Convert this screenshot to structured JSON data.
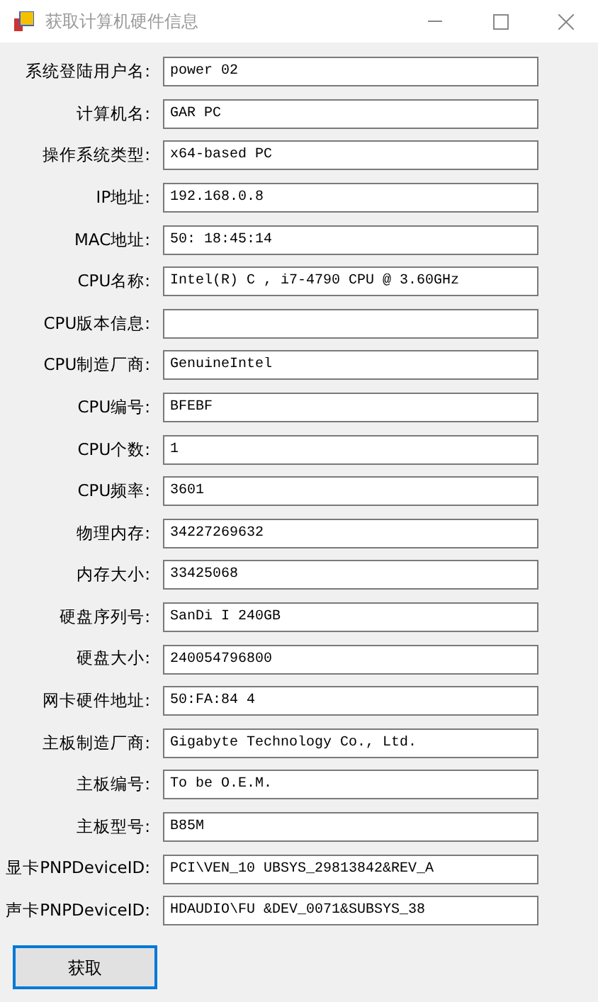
{
  "window": {
    "title": "获取计算机硬件信息"
  },
  "fields": [
    {
      "label": "系统登陆用户名:",
      "value": "power 02"
    },
    {
      "label": "计算机名:",
      "value": "GAR PC"
    },
    {
      "label": "操作系统类型:",
      "value": "x64-based PC"
    },
    {
      "label": "IP地址:",
      "value": "192.168.0.8"
    },
    {
      "label": "MAC地址:",
      "value": "50: 18:45:14"
    },
    {
      "label": "CPU名称:",
      "value": "Intel(R) C , i7-4790 CPU @ 3.60GHz"
    },
    {
      "label": "CPU版本信息:"
    },
    {
      "label": "CPU制造厂商:",
      "value": "GenuineIntel"
    },
    {
      "label": "CPU编号:",
      "value": "BFEBF"
    },
    {
      "label": "CPU个数:",
      "value": "1"
    },
    {
      "label": "CPU频率:",
      "value": "3601"
    },
    {
      "label": "物理内存:",
      "value": "34227269632"
    },
    {
      "label": "内存大小:",
      "value": "33425068"
    },
    {
      "label": "硬盘序列号:",
      "value": "SanDi I 240GB"
    },
    {
      "label": "硬盘大小:",
      "value": "240054796800"
    },
    {
      "label": "网卡硬件地址:",
      "value": "50:FA:84 4"
    },
    {
      "label": "主板制造厂商:",
      "value": "Gigabyte Technology Co., Ltd."
    },
    {
      "label": "主板编号:",
      "value": "To be O.E.M."
    },
    {
      "label": "主板型号:",
      "value": "B85M"
    },
    {
      "label": "显卡PNPDeviceID:",
      "value": "PCI\\VEN_10 UBSYS_29813842&REV_A"
    },
    {
      "label": "声卡PNPDeviceID:",
      "value": "HDAUDIO\\FU &DEV_0071&SUBSYS_38"
    }
  ],
  "button": {
    "label": "获取"
  }
}
